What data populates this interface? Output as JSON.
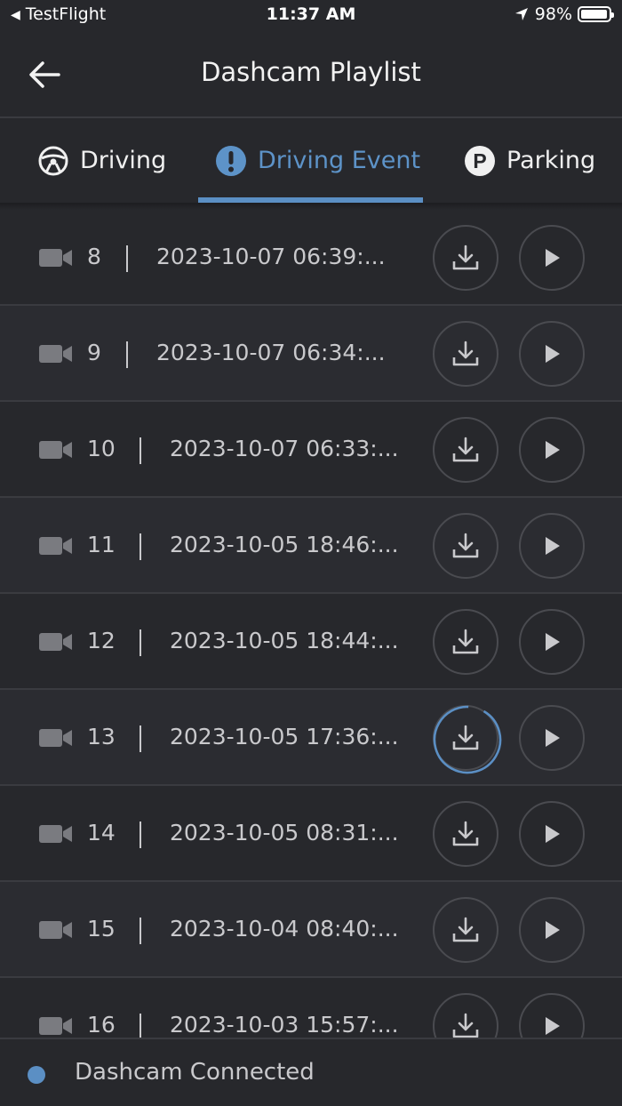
{
  "status_bar": {
    "back_app": "TestFlight",
    "time": "11:37 AM",
    "battery": "98%"
  },
  "header": {
    "title": "Dashcam Playlist"
  },
  "tabs": [
    {
      "label": "Driving",
      "icon": "steering-wheel-icon"
    },
    {
      "label": "Driving Event",
      "icon": "exclamation-circle-icon",
      "active": true
    },
    {
      "label": "Parking",
      "icon": "parking-circle-icon"
    }
  ],
  "recordings": [
    {
      "index": "8",
      "datetime": "2023-10-07 06:39:..."
    },
    {
      "index": "9",
      "datetime": "2023-10-07 06:34:..."
    },
    {
      "index": "10",
      "datetime": "2023-10-07 06:33:..."
    },
    {
      "index": "11",
      "datetime": "2023-10-05 18:46:..."
    },
    {
      "index": "12",
      "datetime": "2023-10-05 18:44:..."
    },
    {
      "index": "13",
      "datetime": "2023-10-05 17:36:...",
      "downloading": true,
      "progress": 0.08
    },
    {
      "index": "14",
      "datetime": "2023-10-05 08:31:..."
    },
    {
      "index": "15",
      "datetime": "2023-10-04 08:40:..."
    },
    {
      "index": "16",
      "datetime": "2023-10-03 15:57:..."
    }
  ],
  "footer": {
    "status_text": "Dashcam Connected",
    "status_color": "#5b8fc4"
  },
  "colors": {
    "accent": "#5b8fc4",
    "background": "#27282c"
  }
}
